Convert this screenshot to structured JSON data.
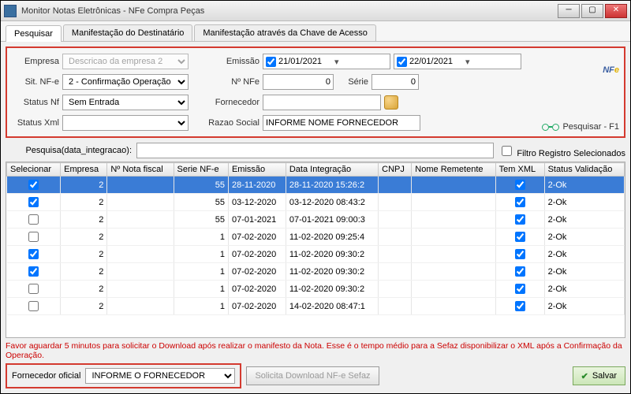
{
  "window": {
    "title": "Monitor Notas Eletrônicas - NFe Compra Peças"
  },
  "tabs": [
    "Pesquisar",
    "Manifestação do Destinatário",
    "Manifestação através da Chave de Acesso"
  ],
  "filters": {
    "empresa_label": "Empresa",
    "empresa_value": "Descricao da empresa 2",
    "sitnfe_label": "Sit. NF-e",
    "sitnfe_value": "2 - Confirmação Operação",
    "statusnf_label": "Status Nf",
    "statusnf_value": "Sem Entrada",
    "statusxml_label": "Status Xml",
    "statusxml_value": "",
    "emissao_label": "Emissão",
    "date_from": "21/01/2021",
    "date_to": "22/01/2021",
    "nnfe_label": "Nº NFe",
    "nnfe_value": "0",
    "serie_label": "Série",
    "serie_value": "0",
    "fornecedor_label": "Fornecedor",
    "fornecedor_value": "",
    "razao_label": "Razao Social",
    "razao_value": "INFORME NOME FORNECEDOR"
  },
  "logo": {
    "text_nf": "NF",
    "text_e": "e"
  },
  "pesquisar_link": "Pesquisar - F1",
  "search": {
    "label": "Pesquisa(data_integracao):",
    "value": "",
    "filtro_label": "Filtro Registro Selecionados"
  },
  "columns": [
    "Selecionar",
    "Empresa",
    "Nº Nota fiscal",
    "Serie NF-e",
    "Emissão",
    "Data Integração",
    "CNPJ",
    "Nome Remetente",
    "Tem XML",
    "Status Validação"
  ],
  "rows": [
    {
      "sel": true,
      "empresa": "2",
      "nota": "",
      "serie": "55",
      "emissao": "28-11-2020",
      "dataint": "28-11-2020 15:26:2",
      "cnpj": "",
      "nome": "",
      "temxml": true,
      "status": "2-Ok",
      "selected_row": true
    },
    {
      "sel": true,
      "empresa": "2",
      "nota": "",
      "serie": "55",
      "emissao": "03-12-2020",
      "dataint": "03-12-2020 08:43:2",
      "cnpj": "",
      "nome": "",
      "temxml": true,
      "status": "2-Ok"
    },
    {
      "sel": false,
      "empresa": "2",
      "nota": "",
      "serie": "55",
      "emissao": "07-01-2021",
      "dataint": "07-01-2021 09:00:3",
      "cnpj": "",
      "nome": "",
      "temxml": true,
      "status": "2-Ok"
    },
    {
      "sel": false,
      "empresa": "2",
      "nota": "",
      "serie": "1",
      "emissao": "07-02-2020",
      "dataint": "11-02-2020 09:25:4",
      "cnpj": "",
      "nome": "",
      "temxml": true,
      "status": "2-Ok"
    },
    {
      "sel": true,
      "empresa": "2",
      "nota": "",
      "serie": "1",
      "emissao": "07-02-2020",
      "dataint": "11-02-2020 09:30:2",
      "cnpj": "",
      "nome": "",
      "temxml": true,
      "status": "2-Ok"
    },
    {
      "sel": true,
      "empresa": "2",
      "nota": "",
      "serie": "1",
      "emissao": "07-02-2020",
      "dataint": "11-02-2020 09:30:2",
      "cnpj": "",
      "nome": "",
      "temxml": true,
      "status": "2-Ok"
    },
    {
      "sel": false,
      "empresa": "2",
      "nota": "",
      "serie": "1",
      "emissao": "07-02-2020",
      "dataint": "11-02-2020 09:30:2",
      "cnpj": "",
      "nome": "",
      "temxml": true,
      "status": "2-Ok"
    },
    {
      "sel": false,
      "empresa": "2",
      "nota": "",
      "serie": "1",
      "emissao": "07-02-2020",
      "dataint": "14-02-2020 08:47:1",
      "cnpj": "",
      "nome": "",
      "temxml": true,
      "status": "2-Ok"
    }
  ],
  "footer_note": "Favor aguardar 5 minutos para solicitar o Download após realizar o manifesto da Nota. Esse é o tempo médio para a Sefaz disponibilizar o XML após a Confirmação da Operação.",
  "bottom": {
    "fornecedor_label": "Fornecedor oficial",
    "fornecedor_value": "INFORME O FORNECEDOR",
    "solicita_label": "Solicita Download NF-e Sefaz",
    "salvar_label": "Salvar"
  }
}
